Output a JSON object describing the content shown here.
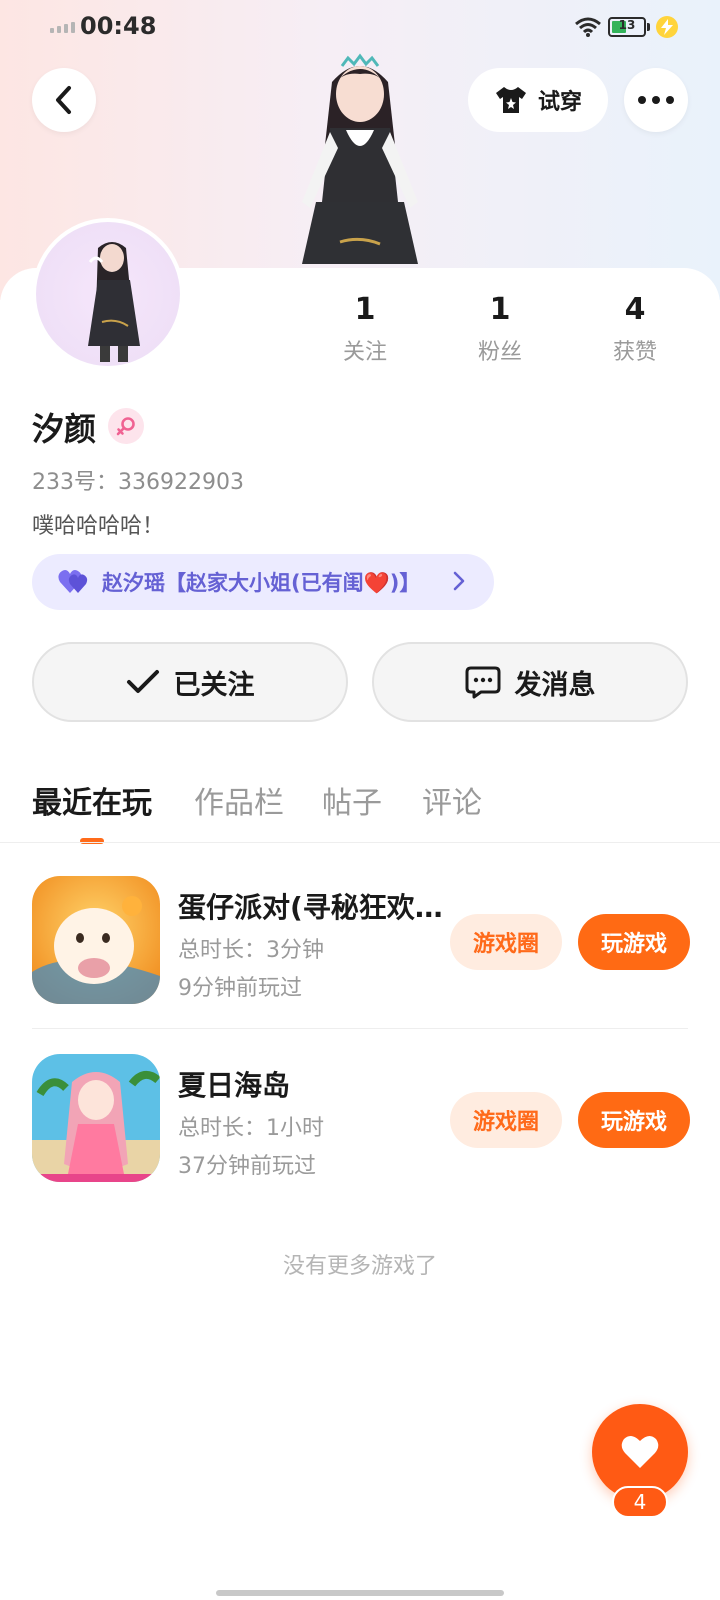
{
  "status_bar": {
    "time": "00:48",
    "battery": "13"
  },
  "header": {
    "try_on_label": "试穿"
  },
  "profile": {
    "name": "汐颜",
    "uid": "233号：336922903",
    "bio": "噗哈哈哈哈！",
    "relation": "赵汐瑶【赵家大小姐(已有闺❤️)】"
  },
  "stats": [
    {
      "value": "1",
      "label": "关注"
    },
    {
      "value": "1",
      "label": "粉丝"
    },
    {
      "value": "4",
      "label": "获赞"
    }
  ],
  "actions": {
    "follow_label": "已关注",
    "message_label": "发消息"
  },
  "tabs": [
    {
      "label": "最近在玩",
      "active": true
    },
    {
      "label": "作品栏",
      "active": false
    },
    {
      "label": "帖子",
      "active": false
    },
    {
      "label": "评论",
      "active": false
    }
  ],
  "games": [
    {
      "title": "蛋仔派对(寻秘狂欢…",
      "duration": "总时长：3分钟",
      "last_played": "9分钟前玩过",
      "circle_label": "游戏圈",
      "play_label": "玩游戏"
    },
    {
      "title": "夏日海岛",
      "duration": "总时长：1小时",
      "last_played": "37分钟前玩过",
      "circle_label": "游戏圈",
      "play_label": "玩游戏"
    }
  ],
  "footer_text": "没有更多游戏了",
  "like_count": "4",
  "colors": {
    "accent": "#ff6a14",
    "relation_bg": "#ecebff",
    "relation_text": "#6561d4"
  }
}
